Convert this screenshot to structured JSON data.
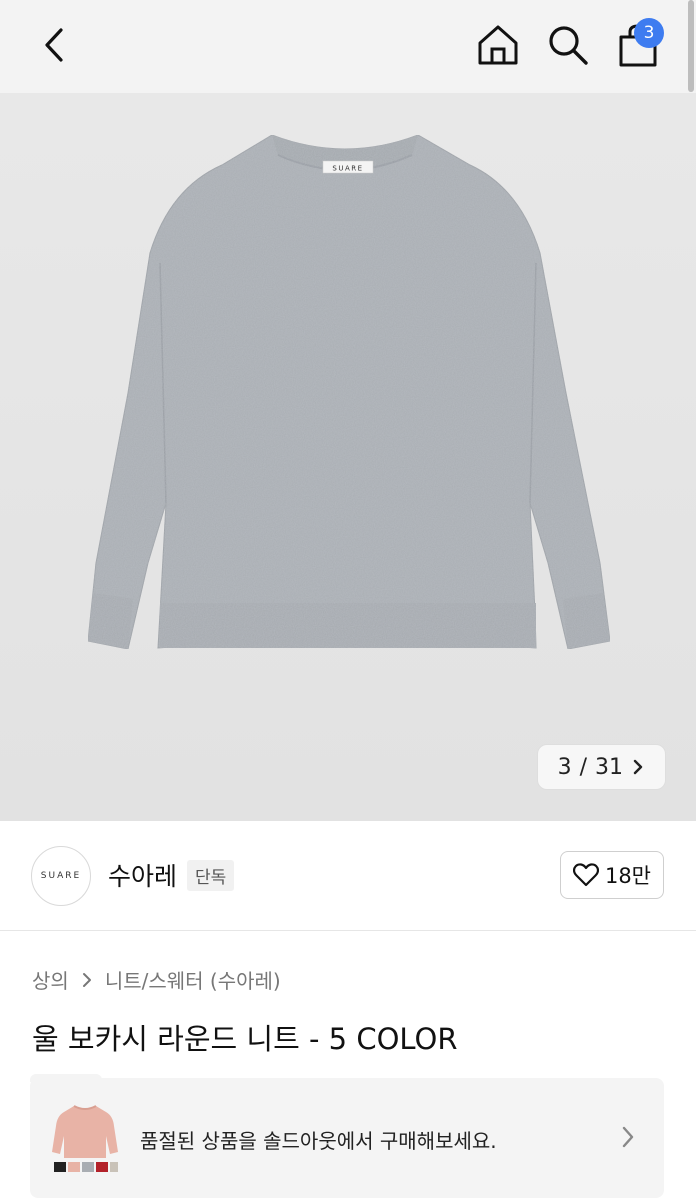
{
  "header": {
    "back_icon": "chevron-left-icon",
    "home_icon": "home-icon",
    "search_icon": "search-icon",
    "cart_icon": "shopping-bag-icon",
    "cart_count": "3",
    "badge_color": "#3e7cf0"
  },
  "gallery": {
    "current": "3",
    "separator": "/",
    "total": "31",
    "next_icon": "chevron-right-icon",
    "label_on_sweater": "SUARE"
  },
  "brand": {
    "logo_text": "SUARE",
    "name": "수아레",
    "tag": "단독",
    "like_icon": "heart-icon",
    "like_count": "18만"
  },
  "breadcrumb": {
    "items": [
      "상의",
      "니트/스웨터 (수아레)"
    ],
    "separator_icon": "chevron-right-icon"
  },
  "product": {
    "title": "울 보카시 라운드 니트 - 5 COLOR"
  },
  "soldout_banner": {
    "text": "품절된 상품을 솔드아웃에서 구매해보세요.",
    "chevron_icon": "chevron-right-icon"
  }
}
